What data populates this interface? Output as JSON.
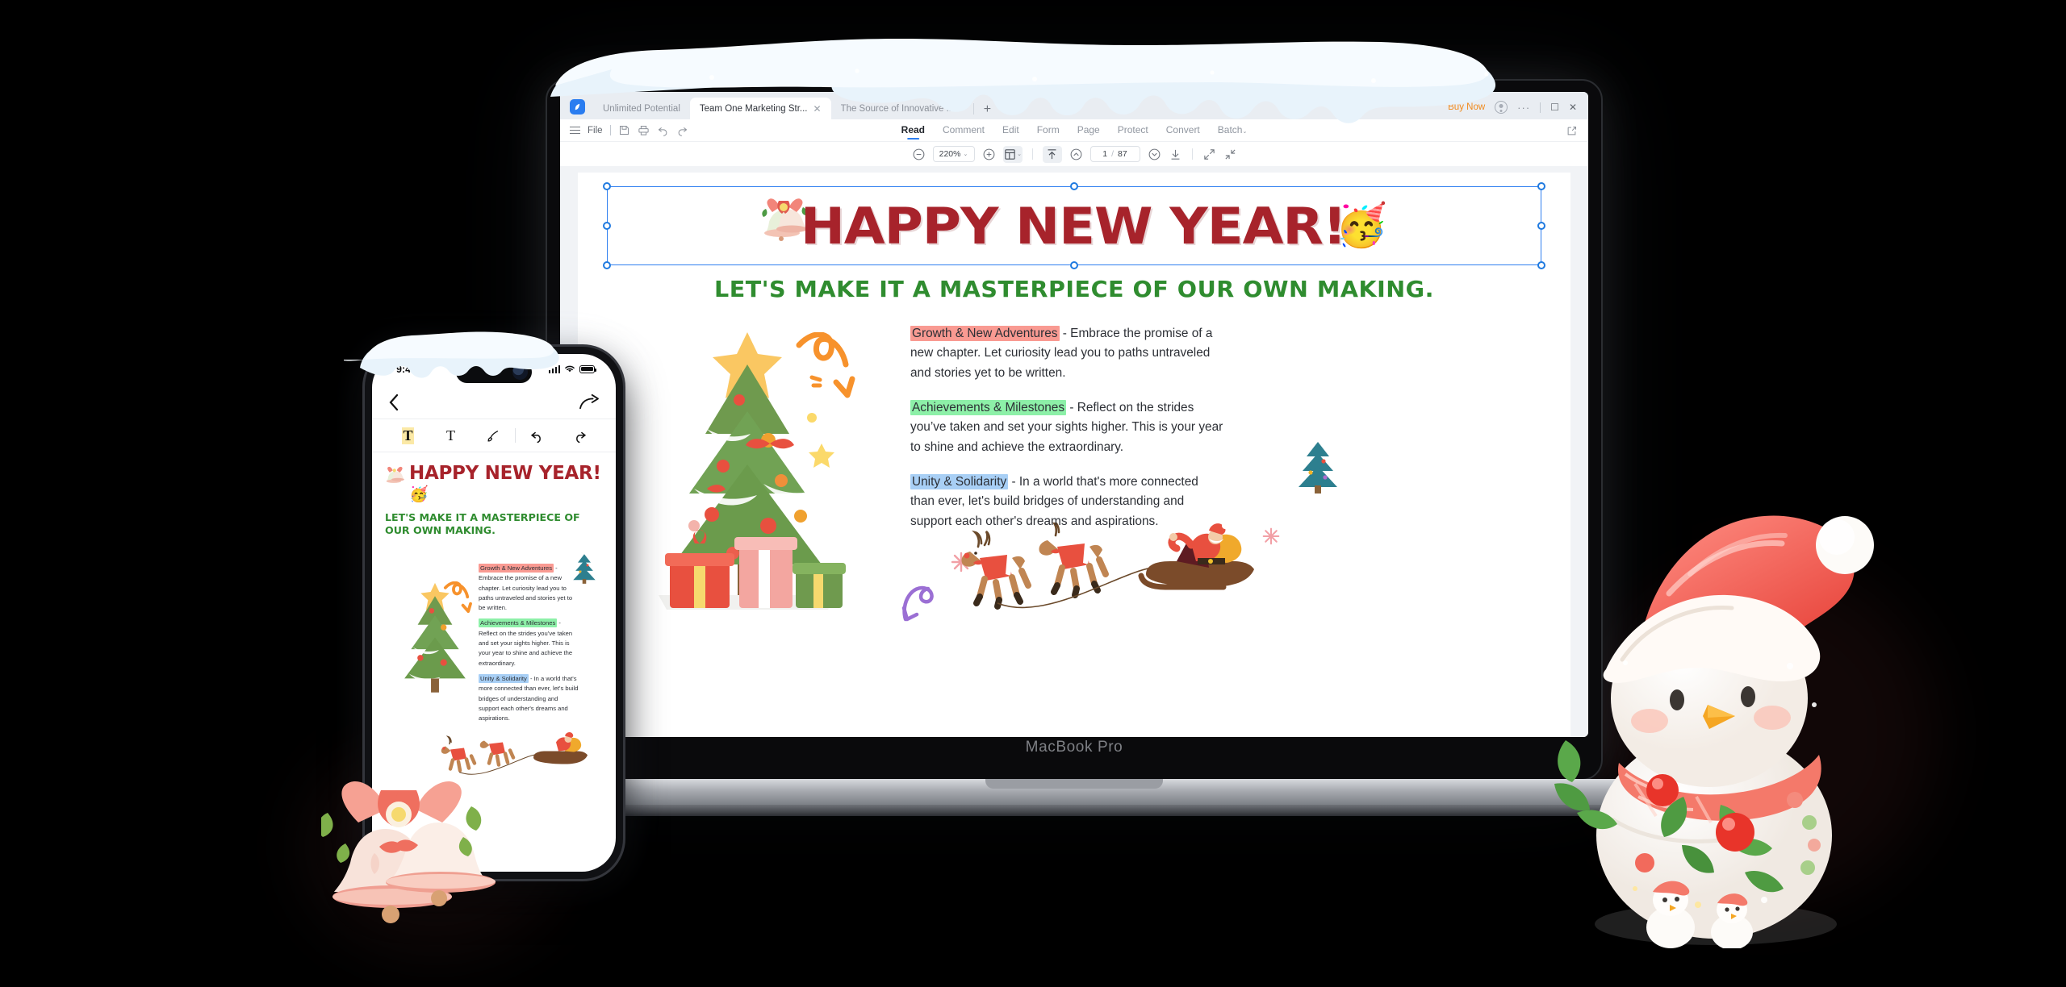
{
  "device": {
    "laptop_label": "MacBook Pro",
    "phone_time": "9:41"
  },
  "titlebar": {
    "tabs": [
      {
        "label": "Unlimited Potential",
        "active": false,
        "closable": false
      },
      {
        "label": "Team One Marketing Str...",
        "active": true,
        "closable": true
      },
      {
        "label": "The Source of Innovative In...",
        "active": false,
        "closable": false
      }
    ],
    "add_tab_label": "+",
    "buy_now_label": "Buy Now",
    "more_label": "···",
    "maximize_label": "☐",
    "close_label": "✕"
  },
  "menubar": {
    "file_label": "File",
    "items": [
      {
        "label": "Read",
        "active": true
      },
      {
        "label": "Comment",
        "active": false
      },
      {
        "label": "Edit",
        "active": false
      },
      {
        "label": "Form",
        "active": false
      },
      {
        "label": "Page",
        "active": false
      },
      {
        "label": "Protect",
        "active": false
      },
      {
        "label": "Convert",
        "active": false
      },
      {
        "label": "Batch",
        "active": false,
        "caret": "⌄"
      }
    ]
  },
  "toolbar": {
    "zoom_value": "220%",
    "zoom_caret": "⌄",
    "layout_caret": "⌄",
    "page_current": "1",
    "page_sep": "/",
    "page_total": "87"
  },
  "document": {
    "title": "HAPPY NEW YEAR!",
    "title_emoji": "🥳",
    "subtitle": "LET'S MAKE IT A MASTERPIECE OF OUR OWN MAKING.",
    "paragraphs": [
      {
        "highlight": "Growth & New Adventures",
        "highlight_color": "red",
        "rest": " - Embrace the promise of a new chapter. Let curiosity lead you to paths untraveled and stories yet to be written."
      },
      {
        "highlight": "Achievements & Milestones",
        "highlight_color": "green",
        "rest": " - Reflect on the strides you’ve taken and set your sights higher. This is your year to shine and achieve the extraordinary."
      },
      {
        "highlight": "Unity & Solidarity",
        "highlight_color": "blue",
        "rest": " - In a world that's more connected than ever, let's build bridges of understanding and support each other's dreams and aspirations."
      }
    ]
  },
  "colors": {
    "accent": "#2a7df0",
    "title_red": "#a7232b",
    "subtitle_green": "#2f8c2f",
    "buy_now_orange": "#f08a1c",
    "highlight_red": "#f99a92",
    "highlight_green": "#8df0a8",
    "highlight_blue": "#a8cff5"
  }
}
